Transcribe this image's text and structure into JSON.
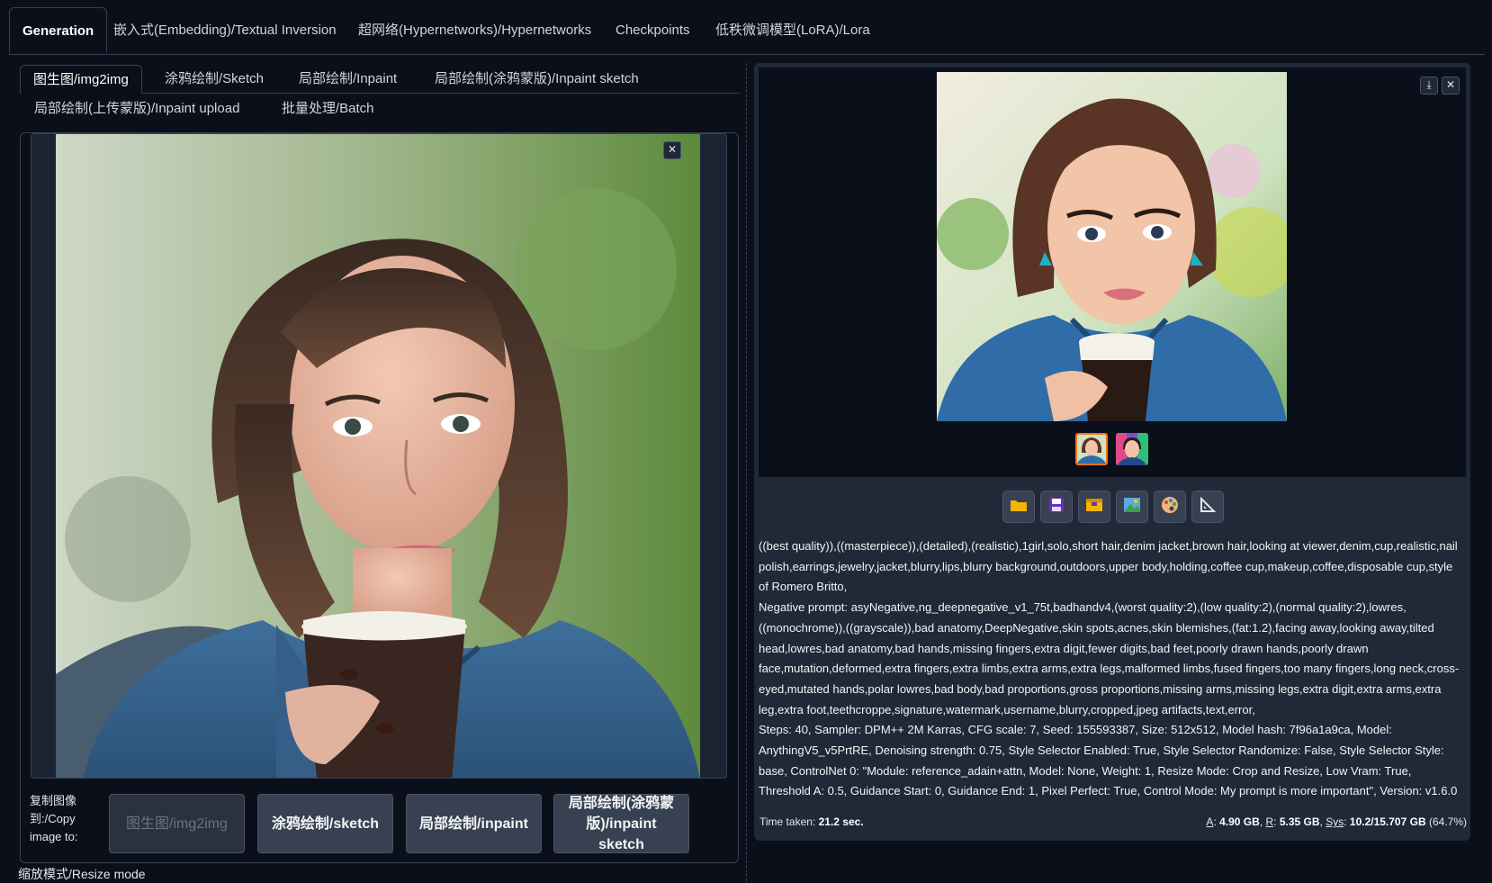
{
  "top_tabs": [
    {
      "label": "Generation",
      "active": true
    },
    {
      "label": "嵌入式(Embedding)/Textual Inversion"
    },
    {
      "label": "超网络(Hypernetworks)/Hypernetworks"
    },
    {
      "label": "Checkpoints"
    },
    {
      "label": "低秩微调模型(LoRA)/Lora"
    }
  ],
  "sub_tabs": [
    {
      "label": "图生图/img2img",
      "active": true
    },
    {
      "label": "涂鸦绘制/Sketch"
    },
    {
      "label": "局部绘制/Inpaint"
    },
    {
      "label": "局部绘制(涂鸦蒙版)/Inpaint sketch"
    },
    {
      "label": "局部绘制(上传蒙版)/Inpaint upload"
    },
    {
      "label": "批量处理/Batch"
    }
  ],
  "copy_image": {
    "label": "复制图像到:/Copy image to:",
    "buttons": [
      "图生图/img2img",
      "涂鸦绘制/sketch",
      "局部绘制/inpaint",
      "局部绘制(涂鸦蒙版)/inpaint sketch"
    ]
  },
  "resize_mode_label": "缩放模式/Resize mode",
  "icons": {
    "close": "close-icon",
    "download": "download-icon",
    "tool_buttons": [
      "folder-icon",
      "save-icon",
      "zip-icon",
      "send-to-img2img-icon",
      "send-to-inpaint-icon",
      "send-to-extras-icon"
    ]
  },
  "output": {
    "prompt": "((best quality)),((masterpiece)),(detailed),(realistic),1girl,solo,short hair,denim jacket,brown hair,looking at viewer,denim,cup,realistic,nail polish,earrings,jewelry,jacket,blurry,lips,blurry background,outdoors,upper body,holding,coffee cup,makeup,coffee,disposable cup,style of Romero Britto,",
    "negative_prompt": "Negative prompt: asyNegative,ng_deepnegative_v1_75t,badhandv4,(worst quality:2),(low quality:2),(normal quality:2),lowres,((monochrome)),((grayscale)),bad anatomy,DeepNegative,skin spots,acnes,skin blemishes,(fat:1.2),facing away,looking away,tilted head,lowres,bad anatomy,bad hands,missing fingers,extra digit,fewer digits,bad feet,poorly drawn hands,poorly drawn face,mutation,deformed,extra fingers,extra limbs,extra arms,extra legs,malformed limbs,fused fingers,too many fingers,long neck,cross-eyed,mutated hands,polar lowres,bad body,bad proportions,gross proportions,missing arms,missing legs,extra digit,extra arms,extra leg,extra foot,teethcroppe,signature,watermark,username,blurry,cropped,jpeg artifacts,text,error,",
    "params": "Steps: 40, Sampler: DPM++ 2M Karras, CFG scale: 7, Seed: 155593387, Size: 512x512, Model hash: 7f96a1a9ca, Model: AnythingV5_v5PrtRE, Denoising strength: 0.75, Style Selector Enabled: True, Style Selector Randomize: False, Style Selector Style: base, ControlNet 0: \"Module: reference_adain+attn, Model: None, Weight: 1, Resize Mode: Crop and Resize, Low Vram: True, Threshold A: 0.5, Guidance Start: 0, Guidance End: 1, Pixel Perfect: True, Control Mode: My prompt is more important\", Version: v1.6.0",
    "time_label": "Time taken:",
    "time_value": "21.2 sec.",
    "mem": {
      "a_label": "A",
      "a_value": "4.90 GB",
      "r_label": "R",
      "r_value": "5.35 GB",
      "sys_label": "Sys",
      "sys_value": "10.2/15.707 GB",
      "sys_pct": "(64.7%)"
    }
  },
  "colors": {
    "background": "#0b0f19",
    "panel": "#1f2937",
    "border": "#374151",
    "selected_thumb": "#f97316"
  }
}
